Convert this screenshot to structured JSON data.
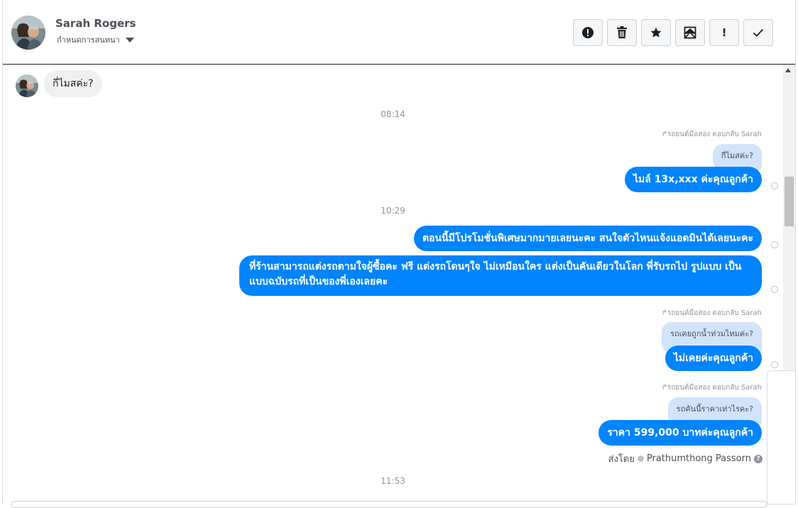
{
  "header": {
    "name": "Sarah Rogers",
    "subtitle": "กำหนดการสนทนา",
    "actions": [
      {
        "icon": "alert-circle-icon",
        "name": "report-button"
      },
      {
        "icon": "trash-icon",
        "name": "delete-button"
      },
      {
        "icon": "star-icon",
        "name": "star-button"
      },
      {
        "icon": "archive-mail-icon",
        "name": "archive-button"
      },
      {
        "icon": "exclamation-icon",
        "name": "mark-important-button",
        "glyph": "!"
      },
      {
        "icon": "check-icon",
        "name": "mark-done-button"
      }
    ]
  },
  "messages": {
    "incoming_1": "กี่ไมสค่ะ?",
    "time_1": "08:14",
    "reply_note_1": "รถยนต์มือสอง ตอบกลับ Sarah",
    "quote_1": "กี่ไมสค่ะ?",
    "out_1": "ไมล์ 13x,xxx  ค่ะคุณลูกค้า",
    "time_2": "10:29",
    "out_2": "ตอนนี้มีโปรโมชั่นพิเศษมากมายเลยนะคะ สนใจตัวไหนแจ้งแอดมินได้เลยนะคะ",
    "out_3": "ที่ร้านสามารถแต่งรถตามใจผู้ซื้อคะ ฟรี แต่งรถโดนๆใจ ไม่เหมือนใคร แต่งเป็นคันเดียวในโลก พี่รับรถไป รูปแบบ เป็นแบบฉบับรถที่เป็นของพี่เองเลยคะ",
    "reply_note_2": "รถยนต์มือสอง ตอบกลับ Sarah",
    "quote_2": "รถเคยถูกน้ำท่วมไหมค่ะ?",
    "out_4": "ไม่เคยค่ะคุณลูกค้า",
    "reply_note_3": "รถยนต์มือสอง ตอบกลับ Sarah",
    "quote_3": "รถคันนี้ราคาเท่าไรคะ?",
    "out_5": "ราคา 599,000 บาทค่ะคุณลูกค้า",
    "sent_by_label": "ส่งโดย",
    "sent_by_name": "Prathumthong Passorn",
    "time_3": "11:53"
  },
  "colors": {
    "accent": "#0084ff",
    "quote_bg": "#d2e3fc",
    "incoming_bg": "#f1f0f0"
  }
}
